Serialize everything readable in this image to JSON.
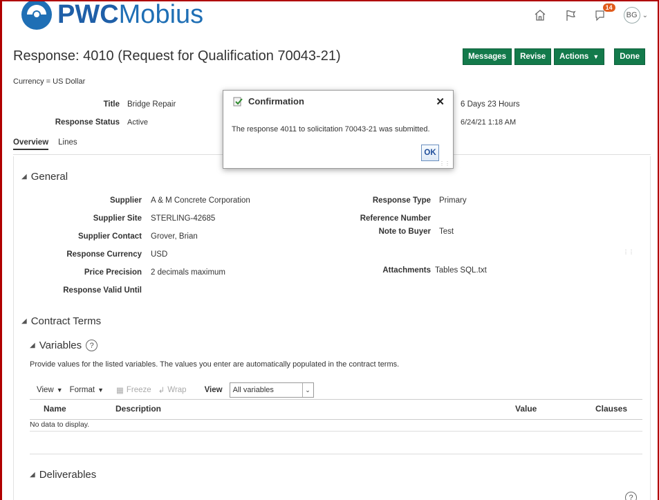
{
  "header": {
    "logo_pwc": "PWC",
    "logo_mobius": "Mobius",
    "notifications_count": "14",
    "user_initials": "BG"
  },
  "page": {
    "title": "Response: 4010 (Request for Qualification 70043-21)",
    "currency": "Currency = US Dollar"
  },
  "buttons": {
    "messages": "Messages",
    "revise": "Revise",
    "actions": "Actions",
    "done": "Done"
  },
  "summary": {
    "title_label": "Title",
    "title_value": "Bridge Repair",
    "status_label": "Response Status",
    "status_value": "Active",
    "time_remaining": "6 Days 23 Hours",
    "close_date": "6/24/21 1:18 AM"
  },
  "tabs": [
    "Overview",
    "Lines"
  ],
  "general": {
    "heading": "General",
    "supplier_label": "Supplier",
    "supplier_value": "A & M Concrete Corporation",
    "supplier_site_label": "Supplier Site",
    "supplier_site_value": "STERLING-42685",
    "supplier_contact_label": "Supplier Contact",
    "supplier_contact_value": "Grover, Brian",
    "response_currency_label": "Response Currency",
    "response_currency_value": "USD",
    "price_precision_label": "Price Precision",
    "price_precision_value": "2 decimals maximum",
    "valid_until_label": "Response Valid Until",
    "response_type_label": "Response Type",
    "response_type_value": "Primary",
    "reference_number_label": "Reference Number",
    "note_to_buyer_label": "Note to Buyer",
    "note_to_buyer_value": "Test",
    "attachments_label": "Attachments",
    "attachments_value": "Tables SQL.txt"
  },
  "contract_terms": {
    "heading": "Contract Terms",
    "variables_heading": "Variables",
    "instructions": "Provide values for the listed variables. The values you enter are automatically populated in the contract terms.",
    "toolbar": {
      "view": "View",
      "format": "Format",
      "freeze": "Freeze",
      "wrap": "Wrap",
      "view_label": "View",
      "view_select": "All variables"
    },
    "columns": [
      "Name",
      "Description",
      "Value",
      "Clauses"
    ],
    "empty_text": "No data to display."
  },
  "deliverables": {
    "heading": "Deliverables"
  },
  "dialog": {
    "title": "Confirmation",
    "message": "The response 4011 to solicitation 70043-21 was submitted.",
    "ok": "OK"
  },
  "colors": {
    "brand_blue": "#1f5fa8",
    "button_green": "#137a4b",
    "badge_orange": "#e05a1b",
    "frame_red": "#b00000"
  }
}
